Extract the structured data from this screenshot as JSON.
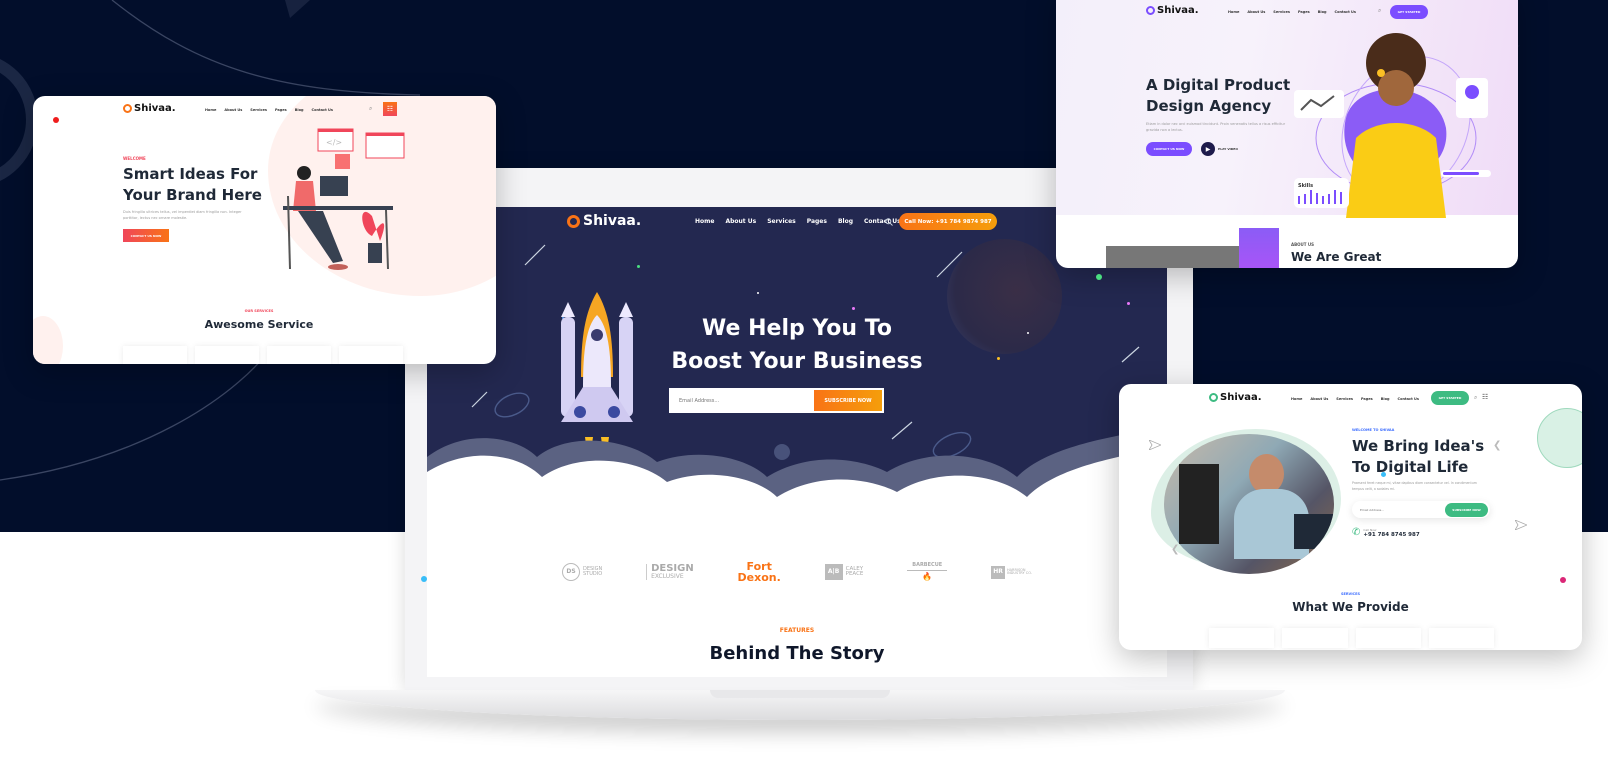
{
  "main_mockup": {
    "nav": {
      "logo": "Shivaa.",
      "links": [
        "Home",
        "About Us",
        "Services",
        "Pages",
        "Blog",
        "Contact Us"
      ],
      "search_icon": "search-icon",
      "cta": "Call Now: +91 784 9874 987"
    },
    "hero": {
      "title_line1": "We Help You To",
      "title_line2": "Boost Your Business",
      "email_placeholder": "Email Address...",
      "subscribe_label": "SUBSCRIBE NOW"
    },
    "brands": [
      {
        "mark": "DS",
        "text1": "DESIGN",
        "text2": "STUDIO"
      },
      {
        "text1": "DESIGN",
        "text2": "EXCLUSIVE"
      },
      {
        "text1": "Fort",
        "text2": "Dexon."
      },
      {
        "mark": "A|B",
        "text1": "CALEY",
        "text2": "PEACE"
      },
      {
        "text1": "BARBECUE",
        "text2": ""
      },
      {
        "mark": "HR",
        "text1": "HARRISON",
        "text2": "INDUSTRY CO."
      }
    ],
    "features": {
      "eyebrow": "FEATURES",
      "title": "Behind The Story"
    }
  },
  "card_left": {
    "nav": {
      "logo": "Shivaa.",
      "links": [
        "Home",
        "About Us",
        "Services",
        "Pages",
        "Blog",
        "Contact Us"
      ]
    },
    "eyebrow": "WELCOME",
    "title_line1": "Smart Ideas For",
    "title_line2": "Your Brand Here",
    "body": "Duis fringilla ultrices tellus, vel imperdiet diam fringilla non. Integer porttitor, lectus nec ornare molestie.",
    "button": "CONTACT US NOW",
    "services_eyebrow": "OUR SERVICES",
    "services_title": "Awesome Service"
  },
  "card_top_right": {
    "nav": {
      "logo": "Shivaa.",
      "links": [
        "Home",
        "About Us",
        "Services",
        "Pages",
        "Blog",
        "Contact Us"
      ],
      "cta": "GET STARTED"
    },
    "title_line1": "A Digital Product",
    "title_line2": "Design Agency",
    "body": "Etiam in dolor nec orci euismod tincidunt. Proin venenatis tellus a risus efficitur gravida non a lectus.",
    "button": "CONTACT US NOW",
    "play_label": "PLAY VIDEO",
    "skills_label": "Skills",
    "about_eyebrow": "ABOUT US",
    "about_title": "We Are Great"
  },
  "card_bottom_right": {
    "nav": {
      "logo": "Shivaa.",
      "links": [
        "Home",
        "About Us",
        "Services",
        "Pages",
        "Blog",
        "Contact Us"
      ],
      "cta": "GET STARTED"
    },
    "eyebrow": "WELCOME TO SHIVAA",
    "title_line1": "We Bring Idea's",
    "title_line2": "To Digital Life",
    "body": "Praesent feret neque mi, vitae dapibus diam consectetur vel. In condimentum tempus velit, a sodales mi.",
    "email_placeholder": "Email Address...",
    "subscribe_label": "SUBSCRIBE NOW",
    "call_label": "Call Now",
    "phone": "+91 784 8745 987",
    "services_eyebrow": "SERVICES",
    "services_title": "What We Provide"
  },
  "colors": {
    "page_dark": "#020e2b",
    "orange": "#f97316",
    "hero_navy": "#232850",
    "left_accent": "#f0465a",
    "purple": "#7b4dff",
    "green": "#3dbb82",
    "blue_eyebrow": "#3b6cff"
  }
}
